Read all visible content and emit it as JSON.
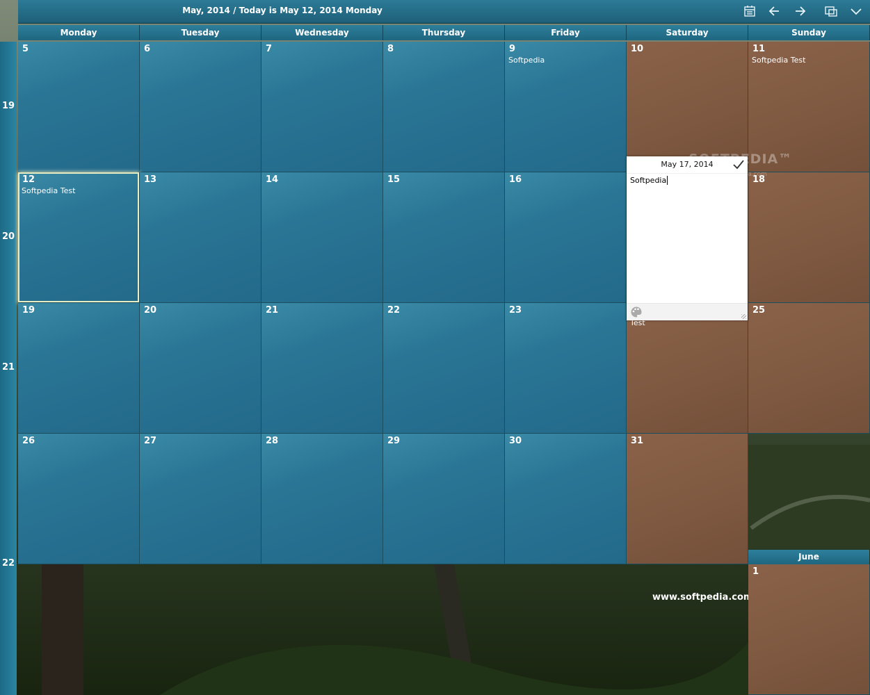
{
  "header": {
    "title": "May, 2014 / Today is May 12, 2014 Monday",
    "icons": [
      "calendar-icon",
      "arrow-left-icon",
      "arrow-right-icon",
      "window-restore-icon",
      "chevron-down-icon"
    ]
  },
  "weekdays": [
    "Monday",
    "Tuesday",
    "Wednesday",
    "Thursday",
    "Friday",
    "Saturday",
    "Sunday"
  ],
  "weeks": [
    {
      "number": "19",
      "days": [
        {
          "day": "5",
          "event": ""
        },
        {
          "day": "6",
          "event": ""
        },
        {
          "day": "7",
          "event": ""
        },
        {
          "day": "8",
          "event": ""
        },
        {
          "day": "9",
          "event": "Softpedia"
        },
        {
          "day": "10",
          "event": ""
        },
        {
          "day": "11",
          "event": "Softpedia Test"
        }
      ]
    },
    {
      "number": "20",
      "days": [
        {
          "day": "12",
          "event": "Softpedia Test"
        },
        {
          "day": "13",
          "event": ""
        },
        {
          "day": "14",
          "event": ""
        },
        {
          "day": "15",
          "event": ""
        },
        {
          "day": "16",
          "event": ""
        },
        {
          "day": "",
          "event": ""
        },
        {
          "day": "18",
          "event": ""
        }
      ]
    },
    {
      "number": "21",
      "days": [
        {
          "day": "19",
          "event": ""
        },
        {
          "day": "20",
          "event": ""
        },
        {
          "day": "21",
          "event": ""
        },
        {
          "day": "22",
          "event": ""
        },
        {
          "day": "23",
          "event": ""
        },
        {
          "day": "",
          "event": ""
        },
        {
          "day": "25",
          "event": ""
        }
      ]
    },
    {
      "number": "22",
      "days": [
        {
          "day": "26",
          "event": ""
        },
        {
          "day": "27",
          "event": ""
        },
        {
          "day": "28",
          "event": ""
        },
        {
          "day": "29",
          "event": ""
        },
        {
          "day": "30",
          "event": ""
        },
        {
          "day": "31",
          "event": ""
        }
      ]
    }
  ],
  "editor": {
    "date": "May 17, 2014",
    "text": "Softpedia",
    "below_text": "Test"
  },
  "next_month": {
    "name": "June",
    "day": "1"
  },
  "background": {
    "watermark": "SOFTPEDIA™",
    "watermark_sub": "www.softpedia.com",
    "url": "www.softpedia.com"
  },
  "colors": {
    "weekday_cell": "#2a7595",
    "weekend_cell": "#7e5840",
    "header": "#1f6680",
    "today_outline": "#e9eec2"
  }
}
